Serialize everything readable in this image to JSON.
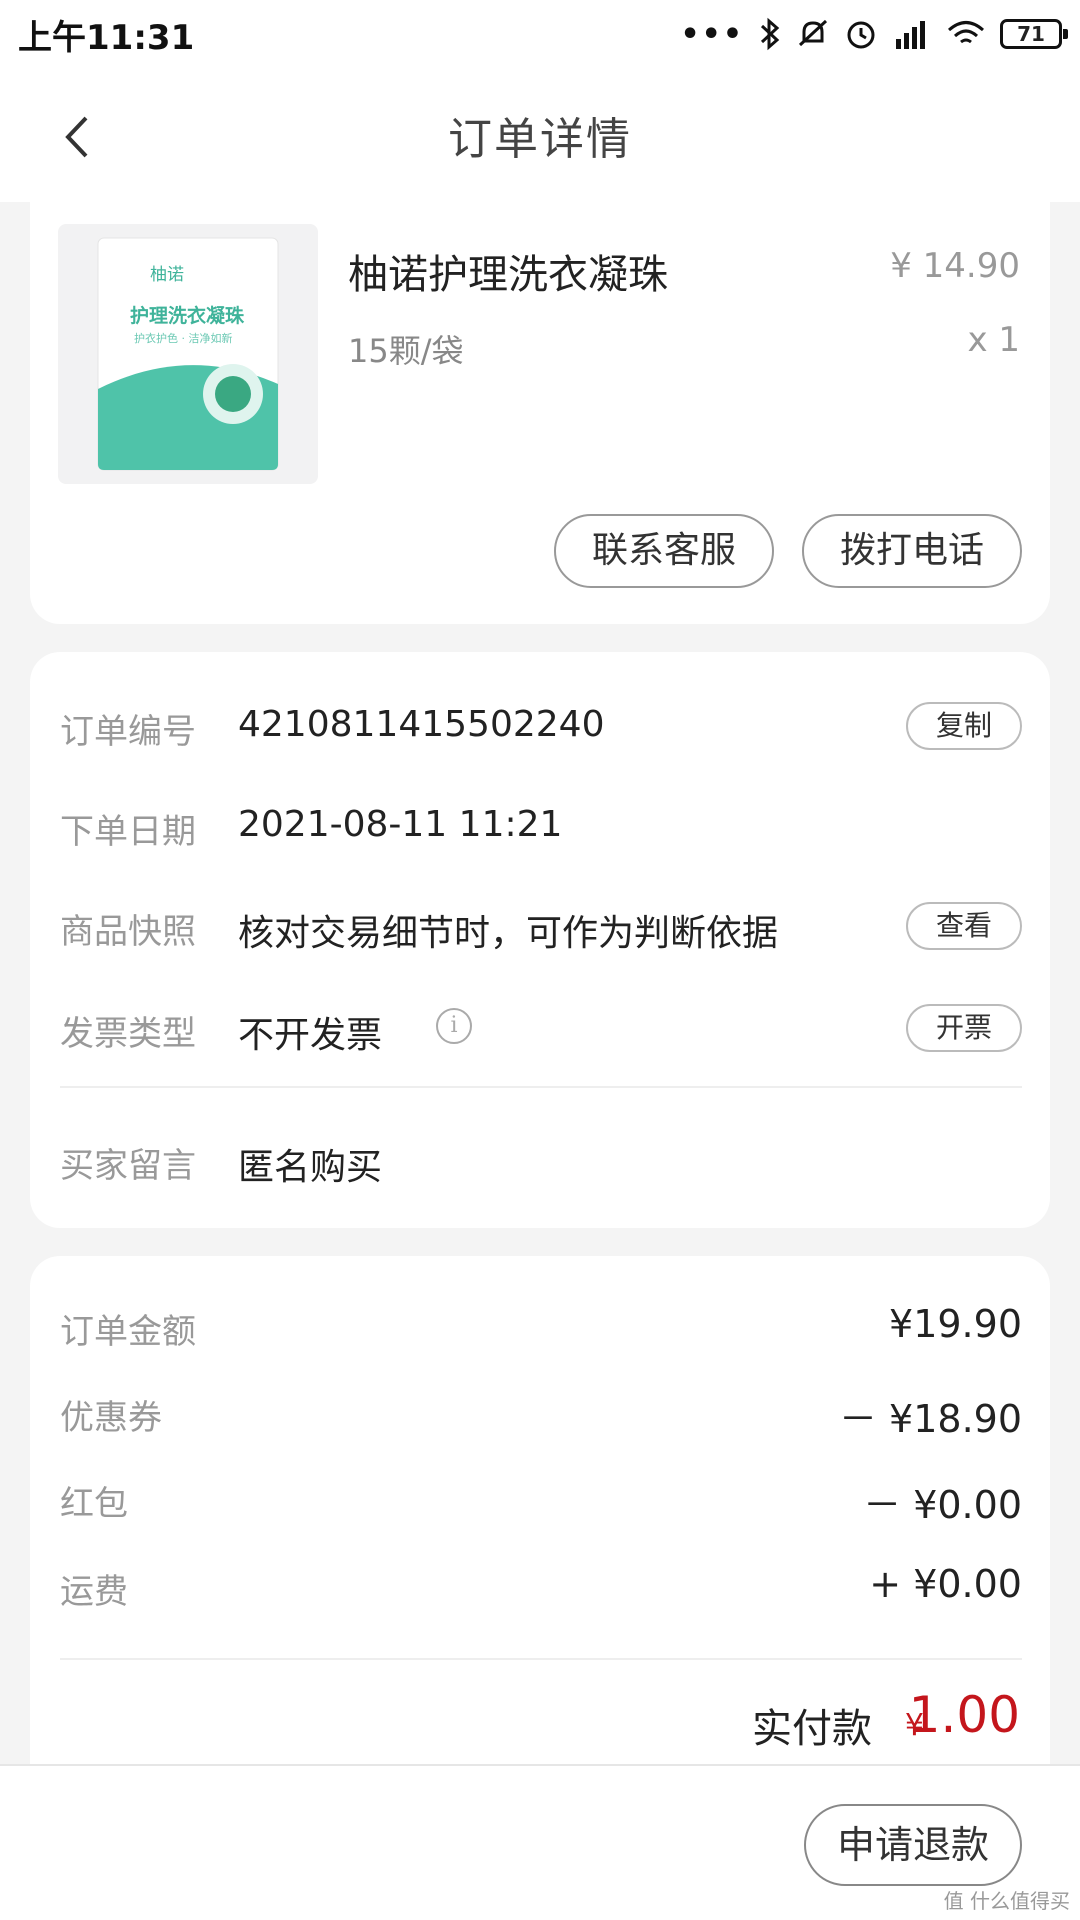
{
  "status_bar": {
    "time": "上午11:31",
    "dots": "•••",
    "battery": "71"
  },
  "nav": {
    "title": "订单详情"
  },
  "product": {
    "name": "柚诺护理洗衣凝珠",
    "spec": "15颗/袋",
    "price": "¥ 14.90",
    "qty": "x 1",
    "image_brand": "柚诺",
    "image_title": "护理洗衣凝珠",
    "image_subtitle": "护衣护色 · 洁净如新",
    "btn_service": "联系客服",
    "btn_call": "拨打电话"
  },
  "order_info": {
    "order_no_label": "订单编号",
    "order_no": "4210811415502240",
    "copy_btn": "复制",
    "date_label": "下单日期",
    "date": "2021-08-11 11:21",
    "snapshot_label": "商品快照",
    "snapshot": "核对交易细节时，可作为判断依据",
    "view_btn": "查看",
    "invoice_label": "发票类型",
    "invoice": "不开发票",
    "info_glyph": "i",
    "invoice_btn": "开票",
    "note_label": "买家留言",
    "note": "匿名购买"
  },
  "amounts": {
    "total_label": "订单金额",
    "total": "¥19.90",
    "coupon_label": "优惠券",
    "coupon": "－ ¥18.90",
    "redpack_label": "红包",
    "redpack": "－ ¥0.00",
    "shipping_label": "运费",
    "shipping": "+ ¥0.00",
    "paid_label": "实付款",
    "paid_currency": "¥",
    "paid": "1.00"
  },
  "bottom": {
    "refund_btn": "申请退款",
    "watermark": "值 什么值得买"
  },
  "colors": {
    "accent_red": "#c4161c",
    "teal": "#4fc3a9"
  }
}
